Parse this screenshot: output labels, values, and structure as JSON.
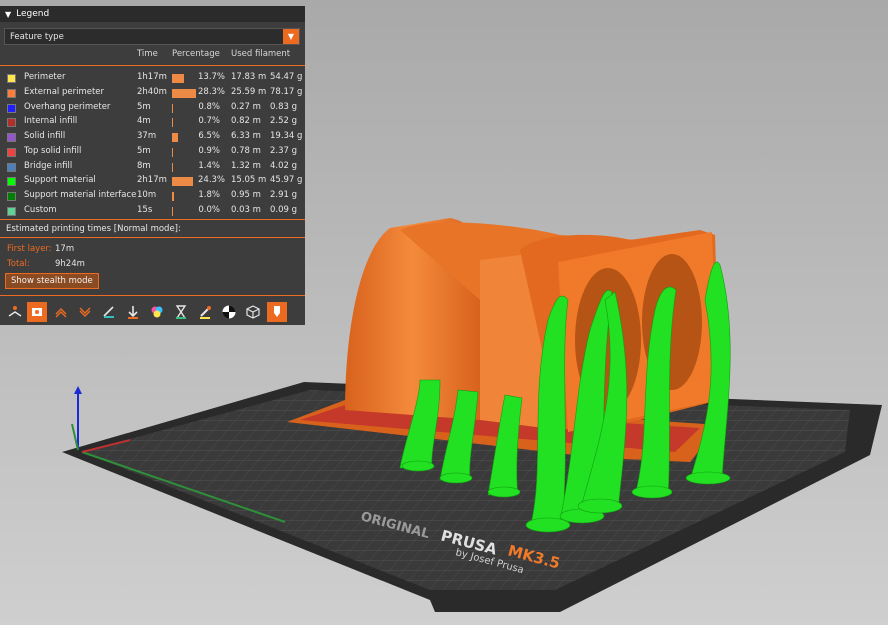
{
  "legend": {
    "title": "Legend",
    "feature_select": "Feature type",
    "columns": {
      "time": "Time",
      "percentage": "Percentage",
      "used_filament": "Used filament"
    },
    "rows": [
      {
        "name": "Perimeter",
        "color": "#ffe64d",
        "time": "1h17m",
        "pct": "13.7%",
        "pct_value": 13.7,
        "length": "17.83 m",
        "weight": "54.47 g"
      },
      {
        "name": "External perimeter",
        "color": "#ff7d38",
        "time": "2h40m",
        "pct": "28.3%",
        "pct_value": 28.3,
        "length": "25.59 m",
        "weight": "78.17 g"
      },
      {
        "name": "Overhang perimeter",
        "color": "#1f1fff",
        "time": "5m",
        "pct": "0.8%",
        "pct_value": 0.8,
        "length": "0.27 m",
        "weight": "0.83 g"
      },
      {
        "name": "Internal infill",
        "color": "#b03029",
        "time": "4m",
        "pct": "0.7%",
        "pct_value": 0.7,
        "length": "0.82 m",
        "weight": "2.52 g"
      },
      {
        "name": "Solid infill",
        "color": "#9654cc",
        "time": "37m",
        "pct": "6.5%",
        "pct_value": 6.5,
        "length": "6.33 m",
        "weight": "19.34 g"
      },
      {
        "name": "Top solid infill",
        "color": "#f04040",
        "time": "5m",
        "pct": "0.9%",
        "pct_value": 0.9,
        "length": "0.78 m",
        "weight": "2.37 g"
      },
      {
        "name": "Bridge infill",
        "color": "#4d80ba",
        "time": "8m",
        "pct": "1.4%",
        "pct_value": 1.4,
        "length": "1.32 m",
        "weight": "4.02 g"
      },
      {
        "name": "Support material",
        "color": "#00ff00",
        "time": "2h17m",
        "pct": "24.3%",
        "pct_value": 24.3,
        "length": "15.05 m",
        "weight": "45.97 g"
      },
      {
        "name": "Support material interface",
        "color": "#008000",
        "time": "10m",
        "pct": "1.8%",
        "pct_value": 1.8,
        "length": "0.95 m",
        "weight": "2.91 g"
      },
      {
        "name": "Custom",
        "color": "#5ed194",
        "time": "15s",
        "pct": "0.0%",
        "pct_value": 0.0,
        "length": "0.03 m",
        "weight": "0.09 g"
      }
    ],
    "estimated_title": "Estimated printing times [Normal mode]:",
    "first_layer_label": "First layer:",
    "first_layer_value": "17m",
    "total_label": "Total:",
    "total_value": "9h24m",
    "stealth_button": "Show stealth mode"
  },
  "toolbar_icons": [
    "travel-icon",
    "wipe-icon",
    "retractions-icon",
    "deretractions-icon",
    "seams-icon",
    "tool-changes-icon",
    "color-changes-icon",
    "pause-prints-icon",
    "custom-gcodes-icon",
    "center-of-gravity-icon",
    "shells-icon",
    "tool-marker-icon"
  ],
  "bed": {
    "brand": "ORIGINAL",
    "brand_name": "PRUSA",
    "model": "MK3.5",
    "byline": "by Josef Prusa"
  },
  "colors": {
    "accent": "#ed6b21",
    "support": "#00ff00",
    "model": "#f07a2a"
  }
}
